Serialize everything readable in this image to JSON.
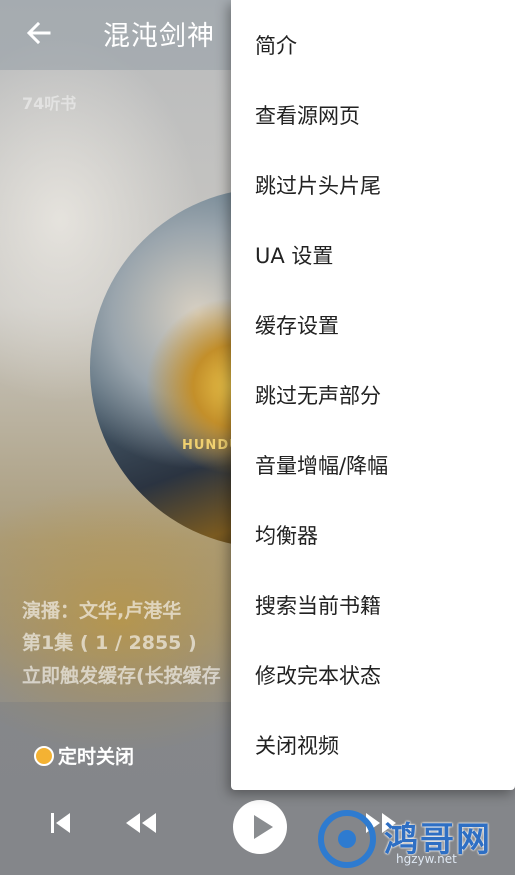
{
  "header": {
    "back_icon": "arrow-left-icon",
    "title": "混沌剑神"
  },
  "source_label": "74听书",
  "artwork": {
    "caption": "HUNDU"
  },
  "info": {
    "narrator": "演播：文华,卢港华",
    "episode": "第1集 ( 1 / 2855 )",
    "cache": "立即触发缓存(长按缓存"
  },
  "timer": {
    "icon": "alarm-clock-icon",
    "label": "定时关闭"
  },
  "controls": [
    "skip-previous-icon",
    "rewind-icon",
    "play-icon",
    "forward-icon"
  ],
  "watermark": {
    "brand": "鸿哥网",
    "url": "hgzyw.net"
  },
  "menu": {
    "items": [
      "简介",
      "查看源网页",
      "跳过片头片尾",
      "UA 设置",
      "缓存设置",
      "跳过无声部分",
      "音量增幅/降幅",
      "均衡器",
      "搜索当前书籍",
      "修改完本状态",
      "关闭视频"
    ]
  }
}
